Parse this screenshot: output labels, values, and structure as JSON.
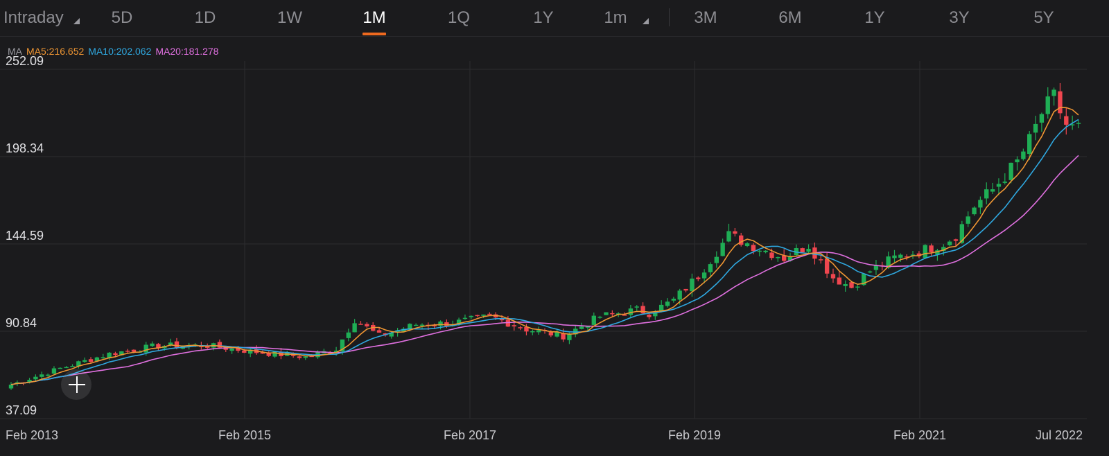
{
  "tabs": [
    {
      "label": "Intraday",
      "dropdown": true
    },
    {
      "label": "5D"
    },
    {
      "label": "1D"
    },
    {
      "label": "1W"
    },
    {
      "label": "1M",
      "active": true
    },
    {
      "label": "1Q"
    },
    {
      "label": "1Y"
    },
    {
      "label": "1m",
      "dropdown": true
    },
    {
      "label": "3M"
    },
    {
      "label": "6M"
    },
    {
      "label": "1Y"
    },
    {
      "label": "3Y"
    },
    {
      "label": "5Y"
    }
  ],
  "ma_legend": {
    "label": "MA",
    "ma5": "MA5:216.652",
    "ma10": "MA10:202.062",
    "ma20": "MA20:181.278"
  },
  "colors": {
    "up": "#1fae55",
    "down": "#f0464f",
    "ma5": "#ef9633",
    "ma10": "#2fa8e0",
    "ma20": "#e070e0",
    "accent": "#ef6a1f",
    "background": "#1b1b1d",
    "grid": "#2c2c30"
  },
  "chart_data": {
    "type": "candlestick",
    "y_ticks": [
      "252.09",
      "198.34",
      "144.59",
      "90.84",
      "37.09"
    ],
    "ylim": [
      37.09,
      252.09
    ],
    "x_ticks": [
      "Feb 2013",
      "Feb 2015",
      "Feb 2017",
      "Feb 2019",
      "Feb 2021",
      "Jul 2022"
    ],
    "x_range": [
      "2013-02",
      "2022-07"
    ],
    "grid": true,
    "anchors": {
      "close": [
        [
          0,
          58
        ],
        [
          8,
          68
        ],
        [
          16,
          77
        ],
        [
          24,
          82
        ],
        [
          32,
          82
        ],
        [
          40,
          78
        ],
        [
          48,
          75
        ],
        [
          53,
          80
        ],
        [
          56,
          98
        ],
        [
          60,
          88
        ],
        [
          66,
          95
        ],
        [
          72,
          96
        ],
        [
          78,
          100
        ],
        [
          84,
          92
        ],
        [
          90,
          88
        ],
        [
          96,
          100
        ],
        [
          102,
          104
        ],
        [
          104,
          102
        ],
        [
          108,
          110
        ],
        [
          112,
          125
        ],
        [
          115,
          140
        ],
        [
          117,
          150
        ],
        [
          120,
          145
        ],
        [
          126,
          136
        ],
        [
          130,
          144
        ],
        [
          134,
          124
        ],
        [
          137,
          118
        ],
        [
          140,
          128
        ],
        [
          144,
          136
        ],
        [
          148,
          140
        ],
        [
          152,
          145
        ],
        [
          154,
          150
        ],
        [
          157,
          168
        ],
        [
          160,
          178
        ],
        [
          164,
          195
        ],
        [
          166,
          208
        ],
        [
          168,
          225
        ],
        [
          170,
          235
        ],
        [
          171,
          226
        ],
        [
          172,
          218
        ],
        [
          173,
          216
        ],
        [
          174,
          216
        ]
      ],
      "ma5": [
        216.652
      ],
      "ma10": [
        202.062
      ],
      "ma20": [
        181.278
      ]
    }
  }
}
